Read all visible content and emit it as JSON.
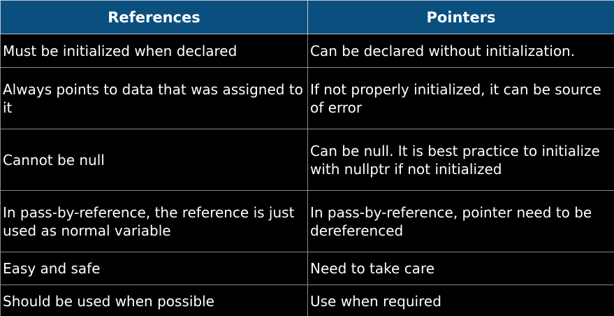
{
  "table": {
    "headers": [
      "References",
      "Pointers"
    ],
    "rows": [
      [
        "Must be initialized when declared",
        "Can be declared without initialization."
      ],
      [
        "Always points to data that was assigned to it",
        "If not properly initialized, it can be source of error"
      ],
      [
        "Cannot be null",
        "Can be null. It is best practice to initialize with nullptr if not initialized"
      ],
      [
        "In pass-by-reference, the reference is just used as normal variable",
        "In pass-by-reference, pointer need to be dereferenced"
      ],
      [
        "Easy and safe",
        "Need to take care"
      ],
      [
        "Should be used when possible",
        "Use when required"
      ]
    ]
  },
  "colors": {
    "header_bg": "#0b4f7f",
    "body_bg": "#000000",
    "text": "#ffffff",
    "grid": "#8a8a8a"
  }
}
